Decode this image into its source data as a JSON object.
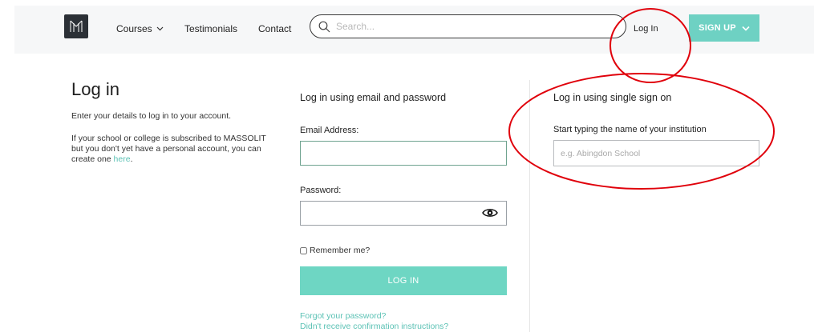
{
  "header": {
    "nav": {
      "courses": "Courses",
      "testimonials": "Testimonials",
      "contact": "Contact"
    },
    "search_placeholder": "Search...",
    "login_label": "Log In",
    "signup_label": "SIGN UP"
  },
  "intro": {
    "title": "Log in",
    "subtitle": "Enter your details to log in to your account.",
    "body": "If your school or college is subscribed to MASSOLIT but you don't yet have a personal account, you can create one ",
    "link": "here",
    "body_end": "."
  },
  "email_login": {
    "heading": "Log in using email and password",
    "email_label": "Email Address:",
    "password_label": "Password:",
    "remember_label": "Remember me?",
    "submit_label": "LOG IN",
    "forgot_link": "Forgot your password?",
    "confirm_link": "Didn't receive confirmation instructions?"
  },
  "sso": {
    "heading": "Log in using single sign on",
    "label": "Start typing the name of your institution",
    "placeholder": "e.g. Abingdon School"
  },
  "colors": {
    "accent": "#6ed1c3",
    "link": "#5cc2b5",
    "annotation": "#e0000b",
    "logo_bg": "#2b3036"
  },
  "icons": {
    "logo": "massolit-logo-icon",
    "courses_chevron": "chevron-down-icon",
    "search": "search-icon",
    "signup_chevron": "chevron-down-icon",
    "password_toggle": "eye-icon"
  }
}
